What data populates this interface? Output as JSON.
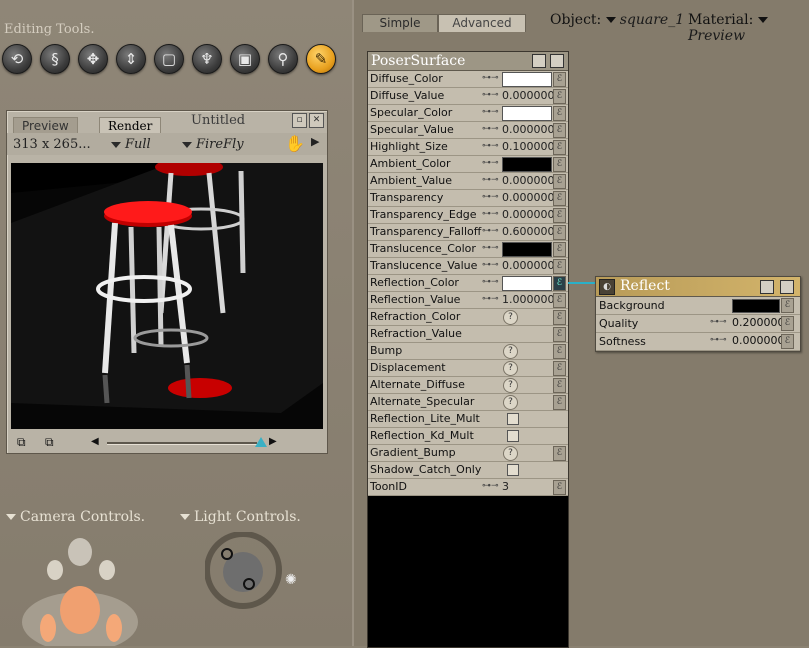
{
  "left": {
    "editing_title": "Editing Tools.",
    "tools": [
      {
        "name": "rotate-icon",
        "glyph": "⟲"
      },
      {
        "name": "twist-icon",
        "glyph": "§"
      },
      {
        "name": "translate-icon",
        "glyph": "✥"
      },
      {
        "name": "translate-in-out-icon",
        "glyph": "⇕"
      },
      {
        "name": "scale-icon",
        "glyph": "▢"
      },
      {
        "name": "taper-icon",
        "glyph": "♆"
      },
      {
        "name": "chain-break-icon",
        "glyph": "▣"
      },
      {
        "name": "view-magnifier-icon",
        "glyph": "⚲"
      },
      {
        "name": "morphing-tool-icon",
        "glyph": "✎"
      }
    ],
    "preview": {
      "tabs": [
        "Preview",
        "Render"
      ],
      "title": "Untitled",
      "size": "313 x 265...",
      "mode": "Full",
      "renderer": "FireFly"
    },
    "camera_controls": "Camera Controls.",
    "light_controls": "Light Controls."
  },
  "material": {
    "tabs": [
      "Simple",
      "Advanced"
    ],
    "object_label": "Object:",
    "object_value": "square_1",
    "material_label": "Material:",
    "material_value": "Preview",
    "poser_title": "PoserSurface",
    "rows": [
      {
        "label": "Diffuse_Color",
        "kind": "color",
        "value": "",
        "color": "#ffffff"
      },
      {
        "label": "Diffuse_Value",
        "kind": "value",
        "value": "0.000000"
      },
      {
        "label": "Specular_Color",
        "kind": "color",
        "value": "",
        "color": "#ffffff"
      },
      {
        "label": "Specular_Value",
        "kind": "value",
        "value": "0.000000"
      },
      {
        "label": "Highlight_Size",
        "kind": "value",
        "value": "0.100000"
      },
      {
        "label": "Ambient_Color",
        "kind": "color",
        "value": "",
        "color": "#000000"
      },
      {
        "label": "Ambient_Value",
        "kind": "value",
        "value": "0.000000"
      },
      {
        "label": "Transparency",
        "kind": "value",
        "value": "0.000000"
      },
      {
        "label": "Transparency_Edge",
        "kind": "value",
        "value": "0.000000"
      },
      {
        "label": "Transparency_Falloff",
        "kind": "value",
        "value": "0.600000"
      },
      {
        "label": "Translucence_Color",
        "kind": "color",
        "value": "",
        "color": "#000000"
      },
      {
        "label": "Translucence_Value",
        "kind": "value",
        "value": "0.000000"
      },
      {
        "label": "Reflection_Color",
        "kind": "color",
        "value": "",
        "color": "#ffffff"
      },
      {
        "label": "Reflection_Value",
        "kind": "value",
        "value": "1.000000"
      },
      {
        "label": "Refraction_Color",
        "kind": "q",
        "value": ""
      },
      {
        "label": "Refraction_Value",
        "kind": "none",
        "value": ""
      },
      {
        "label": "Bump",
        "kind": "q",
        "value": ""
      },
      {
        "label": "Displacement",
        "kind": "q",
        "value": ""
      },
      {
        "label": "Alternate_Diffuse",
        "kind": "q",
        "value": ""
      },
      {
        "label": "Alternate_Specular",
        "kind": "q",
        "value": ""
      },
      {
        "label": "Reflection_Lite_Mult",
        "kind": "check",
        "value": ""
      },
      {
        "label": "Reflection_Kd_Mult",
        "kind": "check",
        "value": ""
      },
      {
        "label": "Gradient_Bump",
        "kind": "q",
        "value": ""
      },
      {
        "label": "Shadow_Catch_Only",
        "kind": "check",
        "value": ""
      },
      {
        "label": "ToonID",
        "kind": "value",
        "value": "3"
      }
    ],
    "reflect": {
      "title": "Reflect",
      "rows": [
        {
          "label": "Background",
          "kind": "color",
          "value": "",
          "color": "#000000"
        },
        {
          "label": "Quality",
          "kind": "value",
          "value": "0.200000"
        },
        {
          "label": "Softness",
          "kind": "value",
          "value": "0.000000"
        }
      ]
    },
    "connector_color": "#2ab0c8"
  }
}
